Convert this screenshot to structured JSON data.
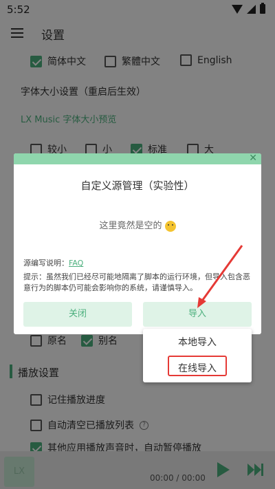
{
  "status_bar": {
    "time": "5:52"
  },
  "header": {
    "title": "设置"
  },
  "language": {
    "options": [
      {
        "label": "简体中文",
        "checked": true
      },
      {
        "label": "繁體中文",
        "checked": false
      },
      {
        "label": "English",
        "checked": false
      }
    ]
  },
  "font_size": {
    "title": "字体大小设置（重启后生效）",
    "preview": "LX Music 字体大小预览",
    "options": [
      {
        "label": "较小",
        "checked": false
      },
      {
        "label": "小",
        "checked": false
      },
      {
        "label": "标准",
        "checked": true
      },
      {
        "label": "大",
        "checked": false
      }
    ]
  },
  "name_options": [
    {
      "label": "原名",
      "checked": false
    },
    {
      "label": "别名",
      "checked": true
    }
  ],
  "playback": {
    "section_title": "播放设置",
    "items": [
      {
        "label": "记住播放进度",
        "checked": false
      },
      {
        "label": "自动清空已播放列表",
        "checked": false
      },
      {
        "label": "其他应用播放声音时，自动暂停播放",
        "checked": true
      }
    ]
  },
  "dialog": {
    "title": "自定义源管理（实验性）",
    "close_symbol": "✕",
    "empty_message": "这里竟然是空的",
    "doc_label": "源编写说明：",
    "doc_link": "FAQ",
    "tip": "提示：虽然我们已经尽可能地隔离了脚本的运行环境，但导入包含恶意行为的脚本仍可能会影响你的系统，请谨慎导入。",
    "close_button": "关闭",
    "import_button": "导入"
  },
  "import_menu": {
    "items": [
      "本地导入",
      "在线导入"
    ]
  },
  "player": {
    "logo": "LX",
    "time": "00:00 / 00:00"
  },
  "colors": {
    "accent": "#4caf7d",
    "annotation": "#e53935"
  }
}
